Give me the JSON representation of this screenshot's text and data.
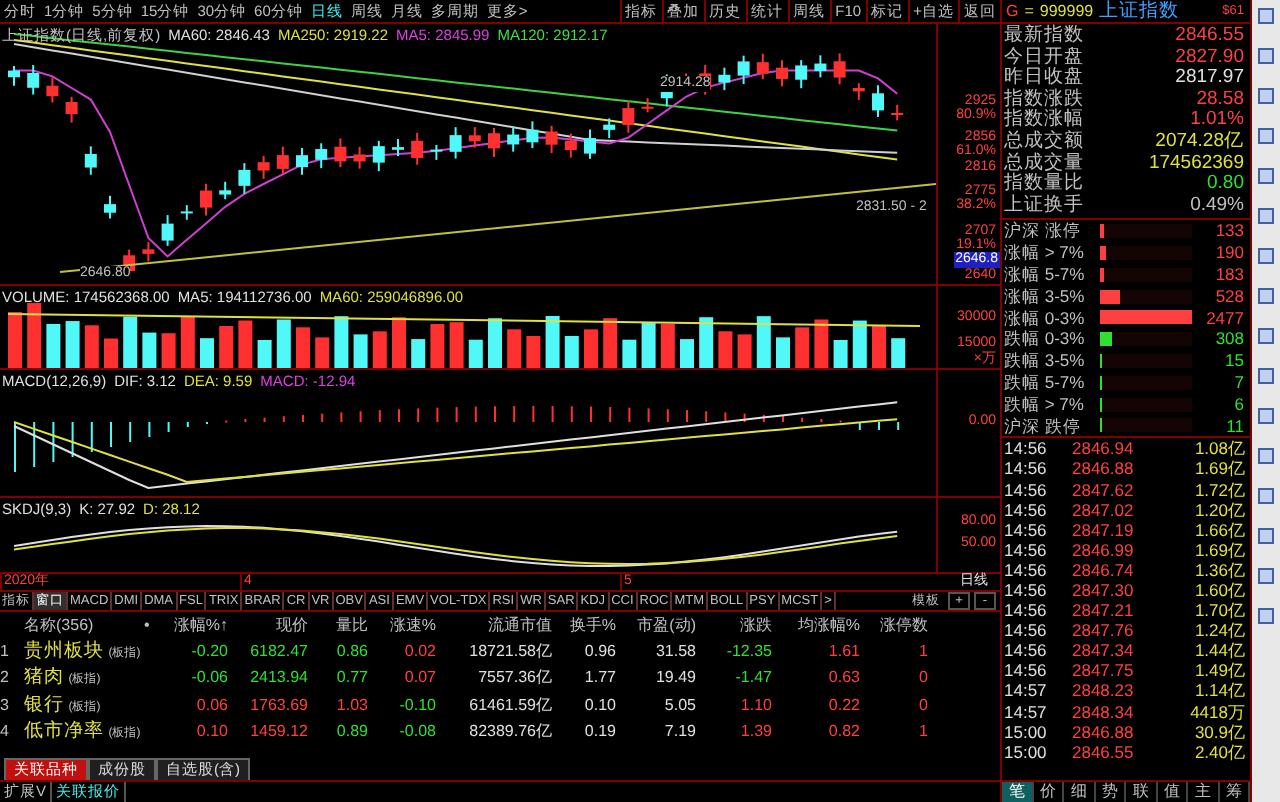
{
  "toolbar": {
    "periods": [
      {
        "label": "分时",
        "selected": false
      },
      {
        "label": "1分钟",
        "selected": false
      },
      {
        "label": "5分钟",
        "selected": false
      },
      {
        "label": "15分钟",
        "selected": false
      },
      {
        "label": "30分钟",
        "selected": false
      },
      {
        "label": "60分钟",
        "selected": false
      },
      {
        "label": "日线",
        "selected": true
      },
      {
        "label": "周线",
        "selected": false
      },
      {
        "label": "月线",
        "selected": false
      },
      {
        "label": "多周期",
        "selected": false
      },
      {
        "label": "更多>",
        "selected": false
      }
    ],
    "buttons": [
      "指标",
      "叠加",
      "历史",
      "统计",
      "周线",
      "F10",
      "标记",
      "+自选",
      "返回"
    ]
  },
  "main_chart": {
    "title": "上证指数(日线,前复权)",
    "legend": [
      {
        "label": "MA60: 2846.43",
        "color": "#e0e0e0"
      },
      {
        "label": "MA250: 2919.22",
        "color": "#e0e040"
      },
      {
        "label": "MA5: 2845.99",
        "color": "#e040e0"
      },
      {
        "label": "MA120: 2912.17",
        "color": "#40e040"
      }
    ],
    "high_label": "2914.28",
    "low_label": "2646.80",
    "last_label": "2831.50 - 2",
    "axis": [
      {
        "text": "2925",
        "kind": "price"
      },
      {
        "text": "80.9%",
        "kind": "pct"
      },
      {
        "text": "2856",
        "kind": "price"
      },
      {
        "text": "61.0%",
        "kind": "pct"
      },
      {
        "text": "2816",
        "kind": "price"
      },
      {
        "text": "2775",
        "kind": "price"
      },
      {
        "text": "38.2%",
        "kind": "pct"
      },
      {
        "text": "2707",
        "kind": "price"
      },
      {
        "text": "19.1%",
        "kind": "pct"
      },
      {
        "text": "2646.8",
        "kind": "current"
      },
      {
        "text": "2640",
        "kind": "price"
      }
    ]
  },
  "volume": {
    "legend": [
      {
        "label": "VOLUME: 174562368.00",
        "color": "#e0e0e0"
      },
      {
        "label": "MA5: 194112736.00",
        "color": "#e0e0e0"
      },
      {
        "label": "MA60: 259046896.00",
        "color": "#e0e040"
      }
    ],
    "axis": [
      "30000",
      "15000",
      "×万"
    ]
  },
  "macd": {
    "legend": [
      {
        "label": "MACD(12,26,9)",
        "color": "#e0e0e0"
      },
      {
        "label": "DIF: 3.12",
        "color": "#e0e0e0"
      },
      {
        "label": "DEA: 9.59",
        "color": "#e0e040"
      },
      {
        "label": "MACD: -12.94",
        "color": "#e040e0"
      }
    ],
    "axis": [
      "0.00"
    ]
  },
  "skdj": {
    "legend": [
      {
        "label": "SKDJ(9,3)",
        "color": "#e0e0e0"
      },
      {
        "label": "K: 27.92",
        "color": "#e0e0e0"
      },
      {
        "label": "D: 28.12",
        "color": "#e0e040"
      }
    ],
    "axis": [
      "80.00",
      "50.00"
    ]
  },
  "date_axis": [
    "2020年",
    "4",
    "5"
  ],
  "period_label": "日线",
  "zoom_buttons": [
    "+",
    "-"
  ],
  "indicator_tabs": [
    {
      "label": "指标",
      "selected": false
    },
    {
      "label": "窗口",
      "selected": true
    },
    {
      "label": "MACD",
      "selected": false
    },
    {
      "label": "DMI",
      "selected": false
    },
    {
      "label": "DMA",
      "selected": false
    },
    {
      "label": "FSL",
      "selected": false
    },
    {
      "label": "TRIX",
      "selected": false
    },
    {
      "label": "BRAR",
      "selected": false
    },
    {
      "label": "CR",
      "selected": false
    },
    {
      "label": "VR",
      "selected": false
    },
    {
      "label": "OBV",
      "selected": false
    },
    {
      "label": "ASI",
      "selected": false
    },
    {
      "label": "EMV",
      "selected": false
    },
    {
      "label": "VOL-TDX",
      "selected": false
    },
    {
      "label": "RSI",
      "selected": false
    },
    {
      "label": "WR",
      "selected": false
    },
    {
      "label": "SAR",
      "selected": false
    },
    {
      "label": "KDJ",
      "selected": false
    },
    {
      "label": "CCI",
      "selected": false
    },
    {
      "label": "ROC",
      "selected": false
    },
    {
      "label": "MTM",
      "selected": false
    },
    {
      "label": "BOLL",
      "selected": false
    },
    {
      "label": "PSY",
      "selected": false
    },
    {
      "label": "MCST",
      "selected": false
    },
    {
      "label": ">",
      "selected": false
    }
  ],
  "template_button": "模板",
  "table": {
    "columns": [
      "名称(356)",
      "•",
      "涨幅%↑",
      "现价",
      "量比",
      "涨速%",
      "流通市值",
      "换手%",
      "市盈(动)",
      "涨跌",
      "均涨幅%",
      "涨停数"
    ],
    "rows": [
      {
        "index": "1",
        "cells": [
          {
            "text": "贵州板块",
            "tag": "(板指)",
            "color": "#e0e040"
          },
          {
            "text": ""
          },
          {
            "text": "-0.20",
            "color": "#30e030"
          },
          {
            "text": "6182.47",
            "color": "#30e030"
          },
          {
            "text": "0.86",
            "color": "#30e030"
          },
          {
            "text": "0.02",
            "color": "#ff4040"
          },
          {
            "text": "18721.58亿",
            "color": "#e0e0e0"
          },
          {
            "text": "0.96",
            "color": "#e0e0e0"
          },
          {
            "text": "31.58",
            "color": "#e0e0e0"
          },
          {
            "text": "-12.35",
            "color": "#30e030"
          },
          {
            "text": "1.61",
            "color": "#ff4040"
          },
          {
            "text": "1",
            "color": "#ff4040"
          }
        ]
      },
      {
        "index": "2",
        "cells": [
          {
            "text": "猪肉",
            "tag": "(板指)",
            "color": "#e0e040"
          },
          {
            "text": ""
          },
          {
            "text": "-0.06",
            "color": "#30e030"
          },
          {
            "text": "2413.94",
            "color": "#30e030"
          },
          {
            "text": "0.77",
            "color": "#30e030"
          },
          {
            "text": "0.07",
            "color": "#ff4040"
          },
          {
            "text": "7557.36亿",
            "color": "#e0e0e0"
          },
          {
            "text": "1.77",
            "color": "#e0e0e0"
          },
          {
            "text": "19.49",
            "color": "#e0e0e0"
          },
          {
            "text": "-1.47",
            "color": "#30e030"
          },
          {
            "text": "0.63",
            "color": "#ff4040"
          },
          {
            "text": "0",
            "color": "#ff4040"
          }
        ]
      },
      {
        "index": "3",
        "cells": [
          {
            "text": "银行",
            "tag": "(板指)",
            "color": "#e0e040"
          },
          {
            "text": ""
          },
          {
            "text": "0.06",
            "color": "#ff4040"
          },
          {
            "text": "1763.69",
            "color": "#ff4040"
          },
          {
            "text": "1.03",
            "color": "#ff4040"
          },
          {
            "text": "-0.10",
            "color": "#30e030"
          },
          {
            "text": "61461.59亿",
            "color": "#e0e0e0"
          },
          {
            "text": "0.10",
            "color": "#e0e0e0"
          },
          {
            "text": "5.05",
            "color": "#e0e0e0"
          },
          {
            "text": "1.10",
            "color": "#ff4040"
          },
          {
            "text": "0.22",
            "color": "#ff4040"
          },
          {
            "text": "0",
            "color": "#ff4040"
          }
        ]
      },
      {
        "index": "4",
        "cells": [
          {
            "text": "低市净率",
            "tag": "(板指)",
            "color": "#e0e040"
          },
          {
            "text": ""
          },
          {
            "text": "0.10",
            "color": "#ff4040"
          },
          {
            "text": "1459.12",
            "color": "#ff4040"
          },
          {
            "text": "0.89",
            "color": "#30e030"
          },
          {
            "text": "-0.08",
            "color": "#30e030"
          },
          {
            "text": "82389.76亿",
            "color": "#e0e0e0"
          },
          {
            "text": "0.19",
            "color": "#e0e0e0"
          },
          {
            "text": "7.19",
            "color": "#e0e0e0"
          },
          {
            "text": "1.39",
            "color": "#ff4040"
          },
          {
            "text": "0.82",
            "color": "#ff4040"
          },
          {
            "text": "1",
            "color": "#ff4040"
          }
        ]
      }
    ]
  },
  "bottom_tabs": [
    {
      "label": "关联品种",
      "selected": true
    },
    {
      "label": "成份股",
      "selected": false
    },
    {
      "label": "自选股(含)",
      "selected": false
    }
  ],
  "status_bar": [
    {
      "label": "扩展V",
      "selected": false
    },
    {
      "label": "关联报价",
      "selected": true
    }
  ],
  "quote_panel": {
    "market": "G",
    "separator": "=",
    "code": "999999",
    "name": "上证指数",
    "badge": "$61",
    "stats": [
      {
        "label": "最新指数",
        "value": "2846.55",
        "color": "#ff4040"
      },
      {
        "label": "今日开盘",
        "value": "2827.90",
        "color": "#ff4040"
      },
      {
        "label": "昨日收盘",
        "value": "2817.97",
        "color": "#e0e0e0"
      },
      {
        "label": "指数涨跌",
        "value": "28.58",
        "color": "#ff4040"
      },
      {
        "label": "指数涨幅",
        "value": "1.01%",
        "color": "#ff4040"
      },
      {
        "label": "总成交额",
        "value": "2074.28亿",
        "color": "#e0e040"
      },
      {
        "label": "总成交量",
        "value": "174562369",
        "color": "#e0e040"
      },
      {
        "label": "指数量比",
        "value": "0.80",
        "color": "#30e030"
      },
      {
        "label": "上证换手",
        "value": "0.49%",
        "color": "#c0c0c0"
      }
    ],
    "breadth": [
      {
        "label": "沪深 涨停",
        "value": "133",
        "level": 0.05,
        "color": "#ff4040"
      },
      {
        "label": "涨幅 > 7%",
        "value": "190",
        "level": 0.06,
        "color": "#ff4040"
      },
      {
        "label": "涨幅 5-7%",
        "value": "183",
        "level": 0.05,
        "color": "#ff4040"
      },
      {
        "label": "涨幅 3-5%",
        "value": "528",
        "level": 0.21,
        "color": "#ff4040"
      },
      {
        "label": "涨幅 0-3%",
        "value": "2477",
        "level": 1,
        "color": "#ff4040"
      },
      {
        "label": "跌幅 0-3%",
        "value": "308",
        "level": 0.12,
        "color": "#30e030"
      },
      {
        "label": "跌幅 3-5%",
        "value": "15",
        "level": 0.01,
        "color": "#30e030"
      },
      {
        "label": "跌幅 5-7%",
        "value": "7",
        "level": 0.01,
        "color": "#30e030"
      },
      {
        "label": "跌幅 > 7%",
        "value": "6",
        "level": 0.01,
        "color": "#30e030"
      },
      {
        "label": "沪深 跌停",
        "value": "11",
        "level": 0.01,
        "color": "#30e030"
      }
    ],
    "ticks": [
      {
        "time": "14:56",
        "price": "2846.94",
        "amount": "1.08亿"
      },
      {
        "time": "14:56",
        "price": "2846.88",
        "amount": "1.69亿"
      },
      {
        "time": "14:56",
        "price": "2847.62",
        "amount": "1.72亿"
      },
      {
        "time": "14:56",
        "price": "2847.02",
        "amount": "1.20亿"
      },
      {
        "time": "14:56",
        "price": "2847.19",
        "amount": "1.66亿"
      },
      {
        "time": "14:56",
        "price": "2846.99",
        "amount": "1.69亿"
      },
      {
        "time": "14:56",
        "price": "2846.74",
        "amount": "1.36亿"
      },
      {
        "time": "14:56",
        "price": "2847.30",
        "amount": "1.60亿"
      },
      {
        "time": "14:56",
        "price": "2847.21",
        "amount": "1.70亿"
      },
      {
        "time": "14:56",
        "price": "2847.76",
        "amount": "1.24亿"
      },
      {
        "time": "14:56",
        "price": "2847.34",
        "amount": "1.44亿"
      },
      {
        "time": "14:56",
        "price": "2847.75",
        "amount": "1.49亿"
      },
      {
        "time": "14:57",
        "price": "2848.23",
        "amount": "1.14亿"
      },
      {
        "time": "14:57",
        "price": "2848.34",
        "amount": "4418万"
      },
      {
        "time": "15:00",
        "price": "2846.88",
        "amount": "30.9亿"
      },
      {
        "time": "15:00",
        "price": "2846.55",
        "amount": "2.40亿"
      }
    ],
    "tabs": [
      {
        "label": "笔",
        "selected": true
      },
      {
        "label": "价",
        "selected": false
      },
      {
        "label": "细",
        "selected": false
      },
      {
        "label": "势",
        "selected": false
      },
      {
        "label": "联",
        "selected": false
      },
      {
        "label": "值",
        "selected": false
      },
      {
        "label": "主",
        "selected": false
      },
      {
        "label": "筹",
        "selected": false
      }
    ]
  }
}
